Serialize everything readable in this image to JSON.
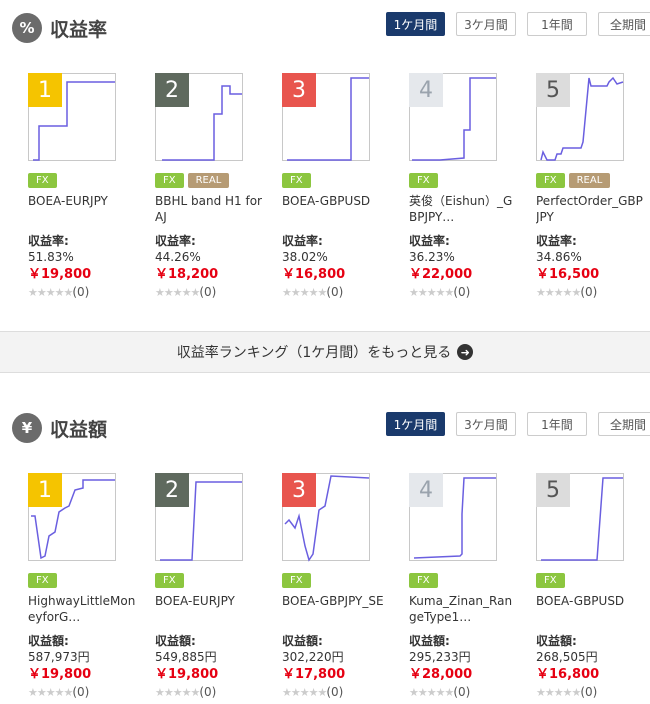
{
  "sections": [
    {
      "icon": "%",
      "title": "収益率",
      "tabs": [
        "1ケ月間",
        "3ケ月間",
        "1年間",
        "全期間"
      ],
      "active_tab": 0,
      "metric_label": "収益率:",
      "cards": [
        {
          "rank": "1",
          "name": "BOEA-EURJPY",
          "tags": [
            "FX"
          ],
          "metric": "51.83%",
          "price": "￥19,800",
          "rating_count": "(0)"
        },
        {
          "rank": "2",
          "name": "BBHL band H1 for AJ",
          "tags": [
            "FX",
            "REAL"
          ],
          "metric": "44.26%",
          "price": "￥18,200",
          "rating_count": "(0)"
        },
        {
          "rank": "3",
          "name": "BOEA-GBPUSD",
          "tags": [
            "FX"
          ],
          "metric": "38.02%",
          "price": "￥16,800",
          "rating_count": "(0)"
        },
        {
          "rank": "4",
          "name": "英俊（Eishun）_GBPJPY…",
          "tags": [
            "FX"
          ],
          "metric": "36.23%",
          "price": "￥22,000",
          "rating_count": "(0)"
        },
        {
          "rank": "5",
          "name": "PerfectOrder_GBPJPY",
          "tags": [
            "FX",
            "REAL"
          ],
          "metric": "34.86%",
          "price": "￥16,500",
          "rating_count": "(0)"
        }
      ]
    },
    {
      "icon": "¥",
      "title": "収益額",
      "tabs": [
        "1ケ月間",
        "3ケ月間",
        "1年間",
        "全期間"
      ],
      "active_tab": 0,
      "metric_label": "収益額:",
      "cards": [
        {
          "rank": "1",
          "name": "HighwayLittleMoneyforG…",
          "tags": [
            "FX"
          ],
          "metric": "587,973円",
          "price": "￥19,800",
          "rating_count": "(0)"
        },
        {
          "rank": "2",
          "name": "BOEA-EURJPY",
          "tags": [
            "FX"
          ],
          "metric": "549,885円",
          "price": "￥19,800",
          "rating_count": "(0)"
        },
        {
          "rank": "3",
          "name": "BOEA-GBPJPY_SE",
          "tags": [
            "FX"
          ],
          "metric": "302,220円",
          "price": "￥17,800",
          "rating_count": "(0)"
        },
        {
          "rank": "4",
          "name": "Kuma_Zinan_RangeType1…",
          "tags": [
            "FX"
          ],
          "metric": "295,233円",
          "price": "￥28,000",
          "rating_count": "(0)"
        },
        {
          "rank": "5",
          "name": "BOEA-GBPUSD",
          "tags": [
            "FX"
          ],
          "metric": "268,505円",
          "price": "￥16,800",
          "rating_count": "(0)"
        }
      ]
    }
  ],
  "more_link": "収益率ランキング（1ケ月間）をもっと見る",
  "stars": "★★★★★",
  "colors": {
    "rank1": "#f5c400",
    "rank2": "#5f6a5e",
    "rank3": "#e8554e",
    "rank4": "#e5e8ec",
    "rank5": "#dcdcdc",
    "line": "#6a5fe0",
    "tab_active": "#1a3a6c",
    "price": "#e60012"
  }
}
